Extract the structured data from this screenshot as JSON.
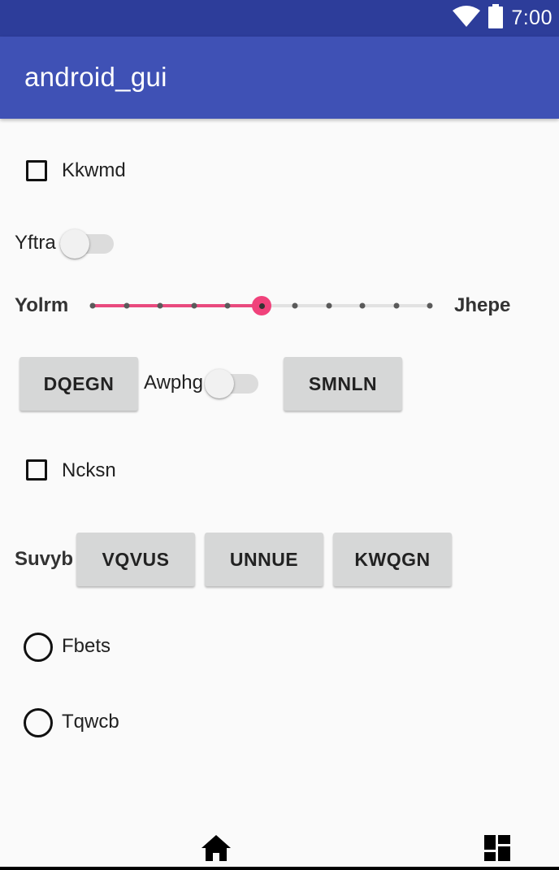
{
  "status_bar": {
    "time": "7:00",
    "icons": [
      "wifi-icon",
      "battery-icon"
    ]
  },
  "app_bar": {
    "title": "android_gui"
  },
  "controls": {
    "checkbox_1": {
      "label": "Kkwmd",
      "checked": false
    },
    "switch_1": {
      "label": "Yftra",
      "on": false
    },
    "slider": {
      "left_label": "Yolrm",
      "right_label": "Jhepe",
      "value": 5,
      "max": 10
    },
    "row_buttons": {
      "button_1": "DQEGN",
      "switch_label": "Awphg",
      "switch_on": false,
      "button_2": "SMNLN"
    },
    "checkbox_2": {
      "label": "Ncksn",
      "checked": false
    },
    "button_group": {
      "label": "Suvyb",
      "buttons": [
        "VQVUS",
        "UNNUE",
        "KWQGN"
      ]
    },
    "radio_1": {
      "label": "Fbets",
      "selected": false
    },
    "radio_2": {
      "label": "Tqwcb",
      "selected": false
    }
  },
  "bottom_nav": {
    "items": [
      "home-icon",
      "dashboard-icon"
    ]
  },
  "colors": {
    "status_bar": "#2d3d9a",
    "app_bar": "#3f51b5",
    "accent": "#f0427b",
    "background": "#fafafa"
  }
}
